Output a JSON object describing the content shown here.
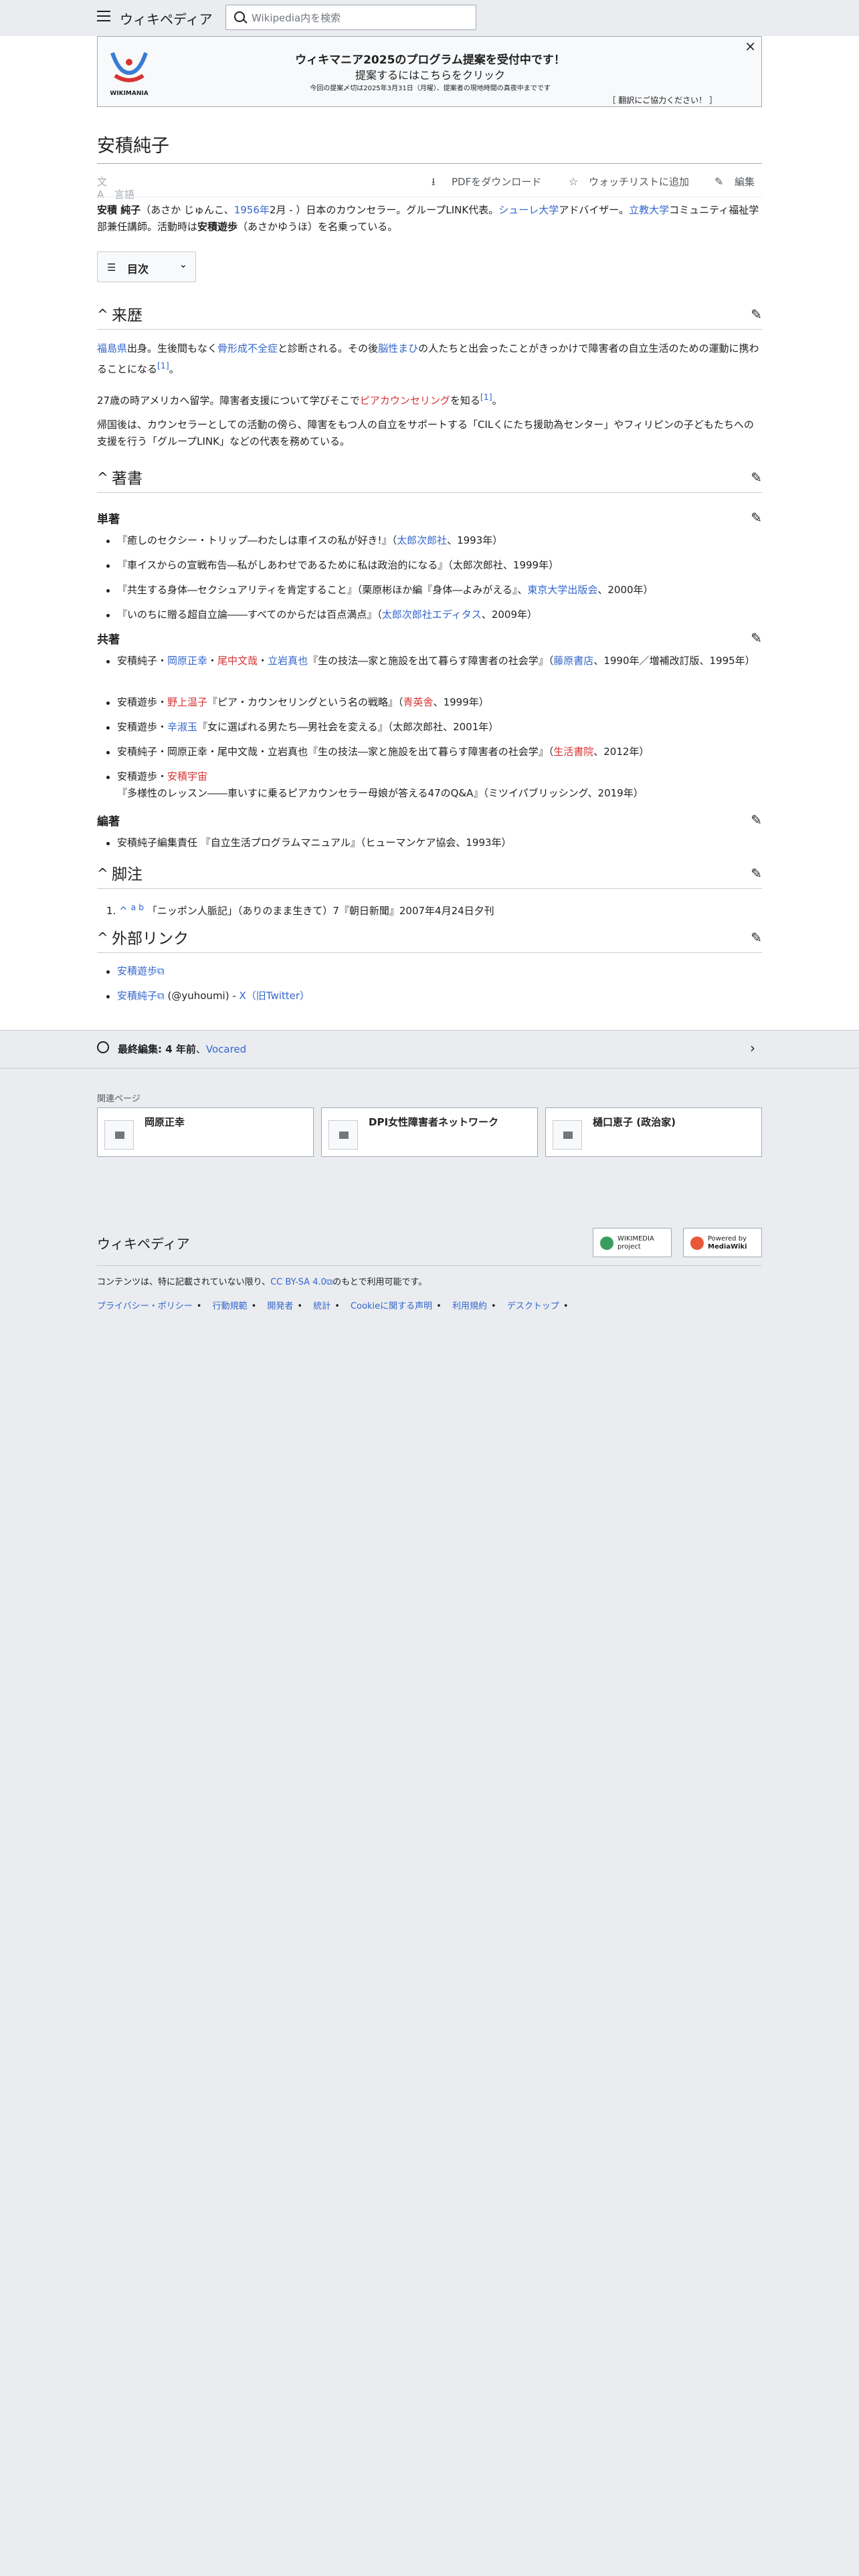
{
  "header": {
    "wordmark": "ウィキペディア",
    "search_placeholder": "Wikipedia内を検索"
  },
  "banner": {
    "logo_text": "WIKIMANIA",
    "line1": "ウィキマニア2025のプログラム提案を受付中です！",
    "line2": "提案するにはこちらをクリック",
    "line3": "今回の提案〆切は2025年3月31日（月曜）、提案者の現地時間の真夜中までです",
    "line4": "［ 翻訳にご協力ください！ ］",
    "close": "×"
  },
  "article": {
    "title": "安積純子",
    "lang_label": "言語",
    "pdf_label": "PDFをダウンロード",
    "watch_label": "ウォッチリストに追加",
    "edit_label": "編集",
    "intro": {
      "name": "安積 純子",
      "reading": "（あさか じゅんこ、",
      "year": "1956年",
      "after_year": "2月 - ）日本のカウンセラー。グループLINK代表。",
      "org1": "シューレ大学",
      "org1_after": "アドバイザー。",
      "org2": "立教大学",
      "org2_after": "コミュニティ福祉学部兼任講師。活動時は",
      "alias": "安積遊歩",
      "alias_after": "（あさかゆうほ）を名乗っている。"
    },
    "toc_label": "目次"
  },
  "history": {
    "heading": "来歴",
    "p1": {
      "place": "福島県",
      "t1": "出身。生後間もなく",
      "disease": "骨形成不全症",
      "t2": "と診断される。その後",
      "org": "脳性まひ",
      "t3": "の人たちと出会ったことがきっかけで障害者の自立生活のための運動に携わることになる",
      "ref": "[1]",
      "t4": "。"
    },
    "p2": {
      "t1": "27歳の時アメリカへ留学。障害者支援について学びそこで",
      "link": "ピアカウンセリング",
      "t2": "を知る",
      "ref": "[1]",
      "t3": "。"
    },
    "p3": "帰国後は、カウンセラーとしての活動の傍ら、障害をもつ人の自立をサポートする「CILくにたち援助為センター」やフィリピンの子どもたちへの支援を行う「グループLINK」などの代表を務めている。"
  },
  "works": {
    "heading": "著書",
    "single_heading": "単著",
    "single": [
      {
        "t1": "『癒しのセクシー・トリップ―わたしは車イスの私が好き!』（",
        "pub": "太郎次郎社",
        "t2": "、1993年）"
      },
      {
        "t1": "『車イスからの宣戦布告―私がしあわせであるために私は政治的になる』（太郎次郎社、1999年）",
        "pub": "",
        "t2": ""
      },
      {
        "t1": "『共生する身体―セクシュアリティを肯定すること』（栗原彬ほか編『身体―よみがえる』、",
        "pub": "東京大学出版会",
        "t2": "、2000年）"
      },
      {
        "t1": "『いのちに贈る超自立論――すべてのからだは百点満点』（",
        "pub": "太郎次郎社エディタス",
        "t2": "、2009年）"
      }
    ],
    "coauthor_heading": "共著",
    "co": {
      "i1_t1": "安積純子・",
      "i1_a1": "岡原正幸",
      "i1_s1": "・",
      "i1_a2": "尾中文哉",
      "i1_s2": "・",
      "i1_a3": "立岩真也",
      "i1_t2": "『生の技法―家と施設を出て暮らす障害者の社会学』（",
      "i1_pub": "藤原書店",
      "i1_t3": "、1990年／増補改訂版、1995年）",
      "i2_t1": "安積遊歩・",
      "i2_a1": "野上温子",
      "i2_t2": "『ピア・カウンセリングという名の戦略』（",
      "i2_pub": "青英舎",
      "i2_t3": "、1999年）",
      "i3_t1": "安積遊歩・",
      "i3_a1": "辛淑玉",
      "i3_t2": "『女に選ばれる男たち―男社会を変える』（太郎次郎社、2001年）",
      "i4_t1": "安積純子・岡原正幸・尾中文哉・立岩真也『生の技法―家と施設を出て暮らす障害者の社会学』（",
      "i4_pub": "生活書院",
      "i4_t2": "、2012年）",
      "i5_t1": "安積遊歩・",
      "i5_a1": "安積宇宙",
      "i5_t2": "『多様性のレッスン――車いすに乗るピアカウンセラー母娘が答える47のQ&A』（ミツイパブリッシング、2019年）"
    },
    "edited_heading": "編著",
    "edited": "安積純子編集責任 『自立生活プログラムマニュアル』（ヒューマンケア協会、1993年）"
  },
  "notes": {
    "heading": "脚注",
    "num": "1.",
    "caret": "^",
    "a": "a",
    "b": "b",
    "text": "「ニッポン人脈記」（ありのまま生きて）7『朝日新聞』2007年4月24日夕刊"
  },
  "external": {
    "heading": "外部リンク",
    "l1": "安積遊歩",
    "l2": "安積純子",
    "l2_after": "(@yuhoumi) - ",
    "l2_x": "X（旧Twitter）"
  },
  "last_edit": {
    "prefix": "最終編集: 4 年前",
    "sep": "、",
    "user": "Vocared"
  },
  "related": {
    "heading": "関連ページ",
    "cards": [
      "岡原正幸",
      "DPI女性障害者ネットワーク",
      "樋口恵子 (政治家)"
    ]
  },
  "footer": {
    "wordmark": "ウィキペディア",
    "badge1": [
      "WIKIMEDIA",
      "project"
    ],
    "badge2": [
      "Powered by",
      "MediaWiki"
    ],
    "license_pre": "コンテンツは、特に記載されていない限り、",
    "license_link": "CC BY-SA 4.0",
    "license_post": "のもとで利用可能です。",
    "links": [
      "プライバシー・ポリシー",
      "行動規範",
      "開発者",
      "統計",
      "Cookieに関する声明",
      "利用規約",
      "デスクトップ"
    ],
    "link_sep": "•"
  },
  "colors": {
    "link": "#3366cc",
    "redlink": "#d73333",
    "border": "#a2a9b1"
  }
}
